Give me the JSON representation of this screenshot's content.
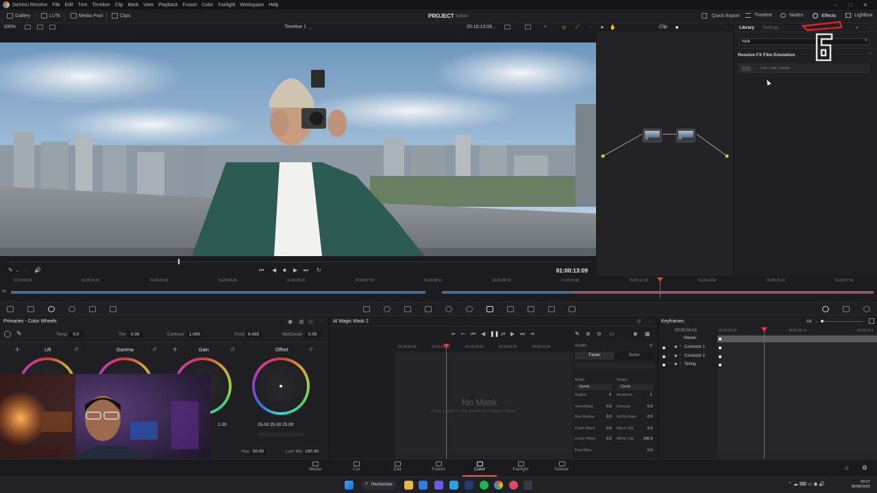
{
  "titlebar": {
    "app": "DaVinci Resolve",
    "menus": [
      "File",
      "Edit",
      "Trim",
      "Timeline",
      "Clip",
      "Mark",
      "View",
      "Playback",
      "Fusion",
      "Color",
      "Fairlight",
      "Workspace",
      "Help"
    ]
  },
  "toolbar": {
    "gallery": "Gallery",
    "luts": "LUTs",
    "media_pool": "Media Pool",
    "clips": "Clips",
    "project_title": "PROJECT",
    "project_status": "Edited",
    "quick_export": "Quick Export",
    "timeline": "Timeline",
    "nodes": "Nodes",
    "effects": "Effects",
    "lightbox": "Lightbox"
  },
  "viewer": {
    "zoom": "100%",
    "timeline_name": "Timeline 1",
    "timecode": "20:16:13:09",
    "clip_mode": "Clip",
    "current_timecode": "01:00:13:09"
  },
  "library": {
    "tab_library": "Library",
    "tab_settings": "Settings",
    "search_value": "look",
    "category": "Resolve FX Film Emulation",
    "item": "Film Look Creator"
  },
  "timeline_strip": {
    "track_label": "V1",
    "ticks": [
      "01:00:00:00",
      "01:00:01:10",
      "01:00:02:20",
      "01:00:04:06",
      "01:00:05:16",
      "01:00:07:02",
      "01:00:08:12",
      "01:00:09:22",
      "01:00:11:08",
      "01:00:12:18",
      "01:00:14:04",
      "01:00:15:14",
      "01:00:17:00"
    ]
  },
  "primaries": {
    "title": "Primaries - Color Wheels",
    "temp_label": "Temp",
    "temp": "0.0",
    "tint_label": "Tint",
    "tint": "0.00",
    "contrast_label": "Contrast",
    "contrast": "1.000",
    "pivot_label": "Pivot",
    "pivot": "0.435",
    "mid_label": "Mid/Detail",
    "mid": "0.00",
    "wheels": [
      {
        "name": "Lift"
      },
      {
        "name": "Gamma"
      },
      {
        "name": "Gain",
        "values": "1.00"
      },
      {
        "name": "Offset",
        "values": "25.00   25.00   25.00"
      }
    ],
    "hue_label": "Hue",
    "hue": "50.00",
    "lummix_label": "Lum Mix",
    "lummix": "100.00"
  },
  "magic_mask": {
    "title": "AI Magic Mask 2",
    "ticks": [
      "00:00:00:00",
      "00:00:03:00",
      "00:00:06:00",
      "00:00:09:00",
      "00:00:12:00"
    ],
    "no_mask": "No Mask",
    "hint": "Draw a path in the viewer to create a mask",
    "quality": "Quality",
    "faster": "Faster",
    "better": "Better",
    "mode_label": "Mode",
    "mode": "Shrink",
    "shape_label": "Shape",
    "shape": "Circle",
    "radius_label": "Radius",
    "radius": "0",
    "iterations_label": "Iterations",
    "iterations": "1",
    "smoothing_label": "Smoothing",
    "smoothing": "0.0",
    "denoise_label": "Denoise",
    "denoise": "0.0",
    "blur_label": "Blur Radius",
    "blur": "0.0",
    "inout_label": "In/Out Ratio",
    "inout": "0.0",
    "cleanblack_label": "Clean Black",
    "cleanblack": "0.0",
    "blackclip_label": "Black Clip",
    "blackclip": "0.0",
    "cleanwhite_label": "Clean White",
    "cleanwhite": "0.0",
    "whiteclip_label": "White Clip",
    "whiteclip": "100.0",
    "postfilter_label": "Post Filter",
    "postfilter": "0.0"
  },
  "keyframes": {
    "title": "Keyframes",
    "filter": "All",
    "timecode": "00:00:04:13",
    "ticks": [
      "00:00:00:00",
      "00:00:06:21",
      "00:00:13:1"
    ],
    "rows": [
      "Master",
      "Corrector 1",
      "Corrector 2",
      "Sizing"
    ]
  },
  "pages": [
    "Media",
    "Cut",
    "Edit",
    "Fusion",
    "Color",
    "Fairlight",
    "Deliver"
  ],
  "active_page": "Color",
  "taskbar": {
    "search": "Rechercher",
    "time": "00:27",
    "date": "08/08/2025"
  },
  "nodes_labels": [
    "01",
    "02"
  ],
  "colors": {
    "accent": "#e0673c",
    "playhead": "#e23b3b",
    "track_blue": "#4a6a8e"
  }
}
